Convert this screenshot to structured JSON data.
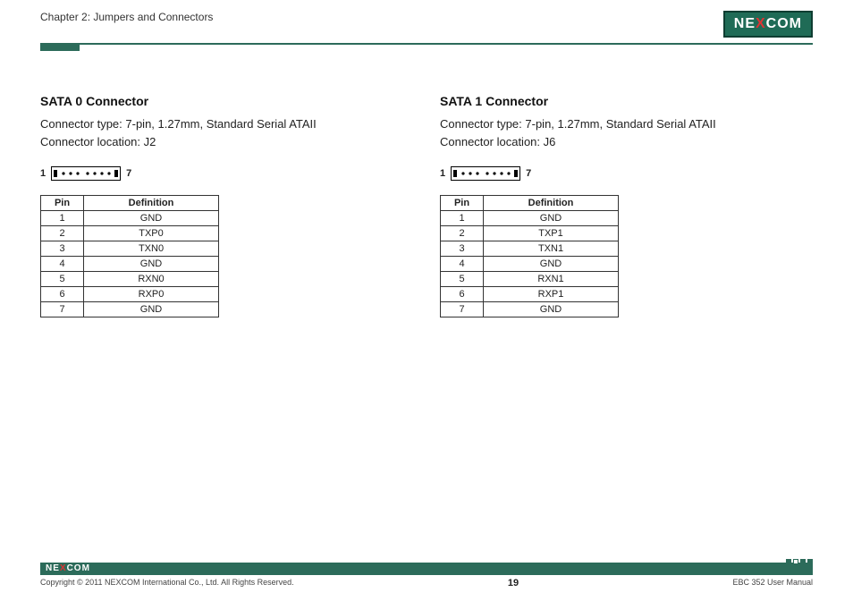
{
  "header": {
    "chapter": "Chapter 2: Jumpers and Connectors",
    "logo_pre": "NE",
    "logo_x": "X",
    "logo_post": "COM"
  },
  "left": {
    "title": "SATA 0 Connector",
    "line1": "Connector type: 7-pin, 1.27mm, Standard Serial ATAII",
    "line2": "Connector location: J2",
    "pin_left": "1",
    "pin_right": "7",
    "th_pin": "Pin",
    "th_def": "Definition",
    "rows": [
      {
        "pin": "1",
        "def": "GND"
      },
      {
        "pin": "2",
        "def": "TXP0"
      },
      {
        "pin": "3",
        "def": "TXN0"
      },
      {
        "pin": "4",
        "def": "GND"
      },
      {
        "pin": "5",
        "def": "RXN0"
      },
      {
        "pin": "6",
        "def": "RXP0"
      },
      {
        "pin": "7",
        "def": "GND"
      }
    ]
  },
  "right": {
    "title": "SATA 1 Connector",
    "line1": "Connector type: 7-pin, 1.27mm, Standard Serial ATAII",
    "line2": "Connector location: J6",
    "pin_left": "1",
    "pin_right": "7",
    "th_pin": "Pin",
    "th_def": "Definition",
    "rows": [
      {
        "pin": "1",
        "def": "GND"
      },
      {
        "pin": "2",
        "def": "TXP1"
      },
      {
        "pin": "3",
        "def": "TXN1"
      },
      {
        "pin": "4",
        "def": "GND"
      },
      {
        "pin": "5",
        "def": "RXN1"
      },
      {
        "pin": "6",
        "def": "RXP1"
      },
      {
        "pin": "7",
        "def": "GND"
      }
    ]
  },
  "footer": {
    "logo_pre": "NE",
    "logo_x": "X",
    "logo_post": "COM",
    "copyright": "Copyright © 2011 NEXCOM International Co., Ltd. All Rights Reserved.",
    "page": "19",
    "doc": "EBC 352 User Manual"
  }
}
